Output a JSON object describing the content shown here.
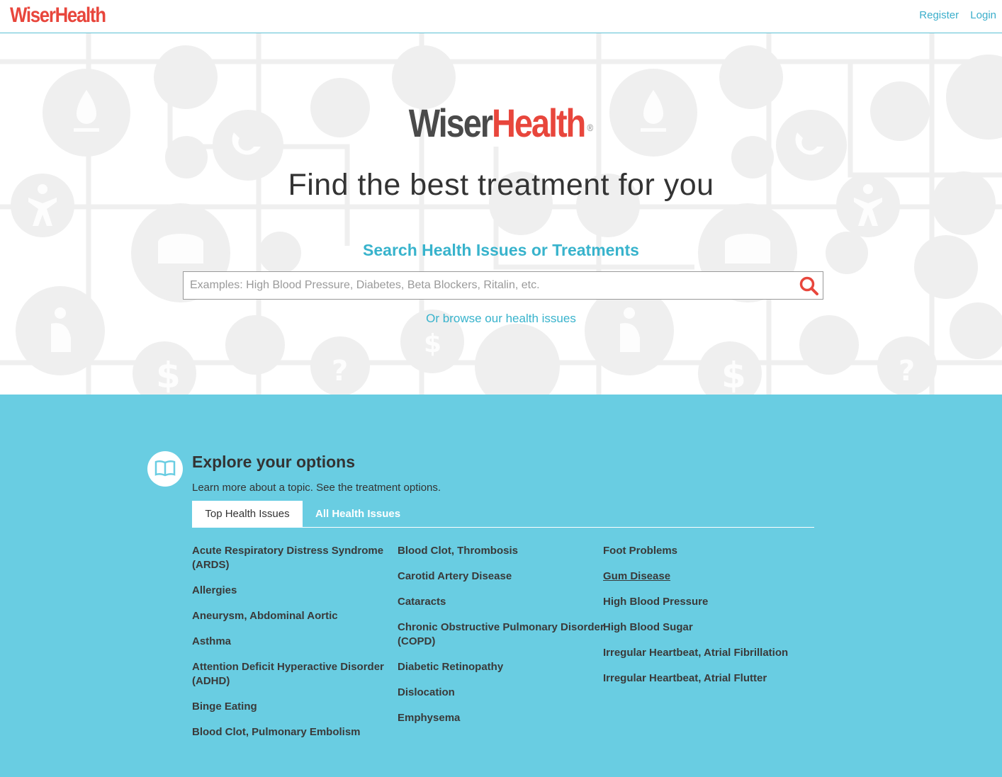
{
  "topnav": {
    "logo": "WiserHealth",
    "register": "Register",
    "login": "Login"
  },
  "hero": {
    "logo_part1": "Wiser",
    "logo_part2": "Health",
    "logo_mark": "®",
    "tagline": "Find the best treatment for you",
    "search_heading": "Search Health Issues or Treatments",
    "search_placeholder": "Examples: High Blood Pressure, Diabetes, Beta Blockers, Ritalin, etc.",
    "search_icon": "search-icon",
    "browse_link": "Or browse our health issues"
  },
  "explore": {
    "icon": "book-icon",
    "title": "Explore your options",
    "subtitle": "Learn more about a topic. See the treatment options.",
    "tabs": [
      {
        "label": "Top Health Issues",
        "active": true
      },
      {
        "label": "All Health Issues",
        "active": false
      }
    ],
    "columns": [
      [
        "Acute Respiratory Distress Syndrome (ARDS)",
        "Allergies",
        "Aneurysm, Abdominal Aortic",
        "Asthma",
        "Attention Deficit Hyperactive Disorder (ADHD)",
        "Binge Eating",
        "Blood Clot, Pulmonary Embolism"
      ],
      [
        "Blood Clot, Thrombosis",
        "Carotid Artery Disease",
        "Cataracts",
        "Chronic Obstructive Pulmonary Disorder (COPD)",
        "Diabetic Retinopathy",
        "Dislocation",
        "Emphysema"
      ],
      [
        "Foot Problems",
        "Gum Disease",
        "High Blood Pressure",
        "High Blood Sugar",
        "Irregular Heartbeat, Atrial Fibrillation",
        "Irregular Heartbeat, Atrial Flutter"
      ]
    ]
  },
  "colors": {
    "brand_red": "#e8463c",
    "accent_teal": "#38b3cc",
    "explore_bg": "#69cde2"
  }
}
